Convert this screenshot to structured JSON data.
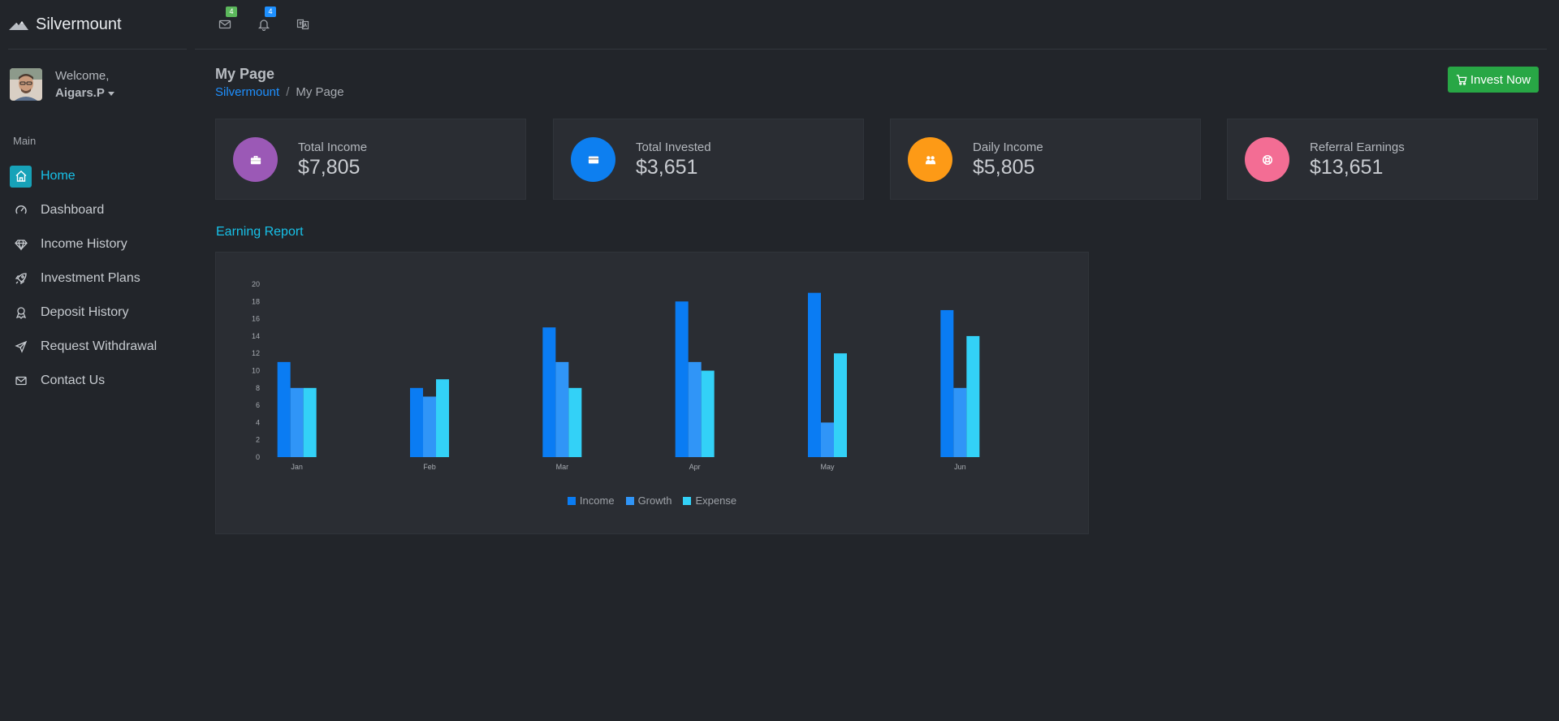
{
  "brand": {
    "name": "Silvermount"
  },
  "user": {
    "welcome": "Welcome,",
    "name": "Aigars.P"
  },
  "sidebar": {
    "caption": "Main",
    "items": [
      {
        "label": "Home",
        "icon": "home-icon",
        "active": true
      },
      {
        "label": "Dashboard",
        "icon": "speedometer-icon",
        "active": false
      },
      {
        "label": "Income History",
        "icon": "diamond-icon",
        "active": false
      },
      {
        "label": "Investment Plans",
        "icon": "rocket-icon",
        "active": false
      },
      {
        "label": "Deposit History",
        "icon": "award-icon",
        "active": false
      },
      {
        "label": "Request Withdrawal",
        "icon": "send-icon",
        "active": false
      },
      {
        "label": "Contact Us",
        "icon": "mail-icon",
        "active": false
      }
    ]
  },
  "topbar": {
    "mail_badge": "4",
    "bell_badge": "4",
    "mail_badge_color": "#5cb85c",
    "bell_badge_color": "#1e90ff"
  },
  "page": {
    "title": "My Page",
    "breadcrumb_home": "Silvermount",
    "breadcrumb_sep": "/",
    "breadcrumb_current": "My Page",
    "invest_button": "Invest Now"
  },
  "stats": [
    {
      "label": "Total Income",
      "value": "$7,805",
      "icon": "briefcase-icon",
      "color": "#9b59b6"
    },
    {
      "label": "Total Invested",
      "value": "$3,651",
      "icon": "credit-card-icon",
      "color": "#0d7ff0"
    },
    {
      "label": "Daily Income",
      "value": "$5,805",
      "icon": "users-icon",
      "color": "#fd9a16"
    },
    {
      "label": "Referral Earnings",
      "value": "$13,651",
      "icon": "lifebuoy-icon",
      "color": "#f36d94"
    }
  ],
  "chart_section": {
    "title": "Earning Report"
  },
  "chart_data": {
    "type": "bar",
    "title": "",
    "xlabel": "",
    "ylabel": "",
    "categories": [
      "Jan",
      "Feb",
      "Mar",
      "Apr",
      "May",
      "Jun"
    ],
    "ylim": [
      0,
      20
    ],
    "yticks": [
      0,
      2,
      4,
      6,
      8,
      10,
      12,
      14,
      16,
      18,
      20
    ],
    "grid": false,
    "legend_position": "bottom",
    "series": [
      {
        "name": "Income",
        "color": "#0a7cf3",
        "values": [
          11,
          8,
          15,
          18,
          19,
          17
        ]
      },
      {
        "name": "Growth",
        "color": "#3095f7",
        "values": [
          8,
          7,
          11,
          11,
          4,
          8
        ]
      },
      {
        "name": "Expense",
        "color": "#33d1f7",
        "values": [
          8,
          9,
          8,
          10,
          12,
          14
        ]
      }
    ]
  }
}
